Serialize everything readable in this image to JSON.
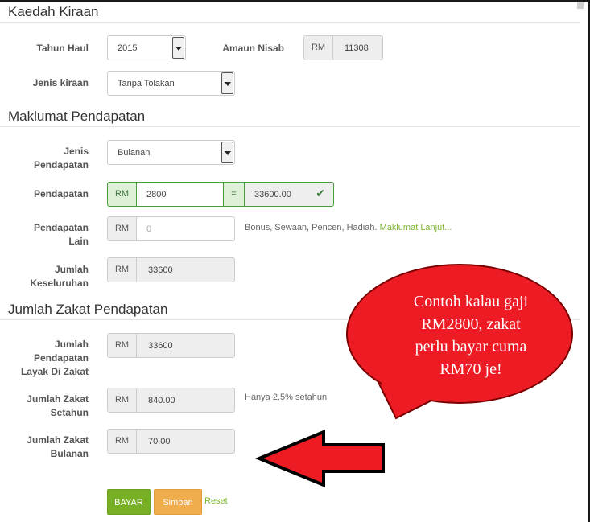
{
  "sections": {
    "kaedah": "Kaedah Kiraan",
    "maklumat": "Maklumat Pendapatan",
    "zakat": "Jumlah Zakat Pendapatan"
  },
  "kaedah": {
    "tahun_haul": {
      "label": "Tahun Haul",
      "value": "2015"
    },
    "amaun_nisab": {
      "label": "Amaun Nisab",
      "addon": "RM",
      "value": "11308"
    },
    "jenis_kiraan": {
      "label": "Jenis kiraan",
      "value": "Tanpa Tolakan"
    }
  },
  "pendapatan": {
    "jenis": {
      "label_line1": "Jenis",
      "label_line2": "Pendapatan",
      "value": "Bulanan"
    },
    "pendapatan": {
      "label": "Pendapatan",
      "addon": "RM",
      "value": "2800",
      "equals": "=",
      "result": "33600.00"
    },
    "lain": {
      "label_line1": "Pendapatan",
      "label_line2": "Lain",
      "addon": "RM",
      "placeholder": "0",
      "help": "Bonus, Sewaan, Pencen, Hadiah.",
      "help_link": "Maklumat Lanjut..."
    },
    "jumlah": {
      "label_line1": "Jumlah",
      "label_line2": "Keseluruhan",
      "addon": "RM",
      "value": "33600"
    }
  },
  "zakat": {
    "layak": {
      "label_line1": "Jumlah",
      "label_line2": "Pendapatan",
      "label_line3": "Layak Di Zakat",
      "addon": "RM",
      "value": "33600"
    },
    "setahun": {
      "label_line1": "Jumlah Zakat",
      "label_line2": "Setahun",
      "addon": "RM",
      "value": "840.00",
      "help": "Hanya 2.5% setahun"
    },
    "bulanan": {
      "label_line1": "Jumlah Zakat",
      "label_line2": "Bulanan",
      "addon": "RM",
      "value": "70.00"
    }
  },
  "actions": {
    "bayar": "BAYAR",
    "simpan": "Simpan",
    "reset": "Reset"
  },
  "annotation": {
    "bubble_line1": "Contoh kalau gaji",
    "bubble_line2": "RM2800, zakat",
    "bubble_line3": "perlu bayar cuma",
    "bubble_line4": "RM70 je!"
  },
  "colors": {
    "success_green": "#3c763d",
    "button_green": "#77b025",
    "button_orange": "#f0ad4e",
    "link_green": "#7bb332",
    "bubble_red": "#ed1c24"
  },
  "icons": [
    "caret-down-icon",
    "checkmark-icon",
    "arrow-left-icon",
    "speech-bubble"
  ]
}
